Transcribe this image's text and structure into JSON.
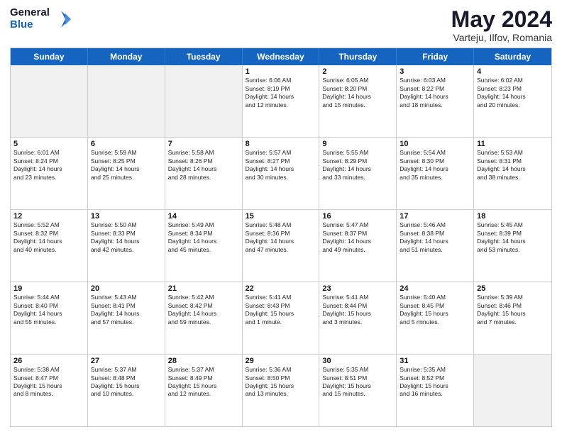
{
  "logo": {
    "line1": "General",
    "line2": "Blue"
  },
  "title": "May 2024",
  "subtitle": "Varteju, Ilfov, Romania",
  "days": [
    "Sunday",
    "Monday",
    "Tuesday",
    "Wednesday",
    "Thursday",
    "Friday",
    "Saturday"
  ],
  "weeks": [
    [
      {
        "day": "",
        "lines": []
      },
      {
        "day": "",
        "lines": []
      },
      {
        "day": "",
        "lines": []
      },
      {
        "day": "1",
        "lines": [
          "Sunrise: 6:06 AM",
          "Sunset: 8:19 PM",
          "Daylight: 14 hours",
          "and 12 minutes."
        ]
      },
      {
        "day": "2",
        "lines": [
          "Sunrise: 6:05 AM",
          "Sunset: 8:20 PM",
          "Daylight: 14 hours",
          "and 15 minutes."
        ]
      },
      {
        "day": "3",
        "lines": [
          "Sunrise: 6:03 AM",
          "Sunset: 8:22 PM",
          "Daylight: 14 hours",
          "and 18 minutes."
        ]
      },
      {
        "day": "4",
        "lines": [
          "Sunrise: 6:02 AM",
          "Sunset: 8:23 PM",
          "Daylight: 14 hours",
          "and 20 minutes."
        ]
      }
    ],
    [
      {
        "day": "5",
        "lines": [
          "Sunrise: 6:01 AM",
          "Sunset: 8:24 PM",
          "Daylight: 14 hours",
          "and 23 minutes."
        ]
      },
      {
        "day": "6",
        "lines": [
          "Sunrise: 5:59 AM",
          "Sunset: 8:25 PM",
          "Daylight: 14 hours",
          "and 25 minutes."
        ]
      },
      {
        "day": "7",
        "lines": [
          "Sunrise: 5:58 AM",
          "Sunset: 8:26 PM",
          "Daylight: 14 hours",
          "and 28 minutes."
        ]
      },
      {
        "day": "8",
        "lines": [
          "Sunrise: 5:57 AM",
          "Sunset: 8:27 PM",
          "Daylight: 14 hours",
          "and 30 minutes."
        ]
      },
      {
        "day": "9",
        "lines": [
          "Sunrise: 5:55 AM",
          "Sunset: 8:29 PM",
          "Daylight: 14 hours",
          "and 33 minutes."
        ]
      },
      {
        "day": "10",
        "lines": [
          "Sunrise: 5:54 AM",
          "Sunset: 8:30 PM",
          "Daylight: 14 hours",
          "and 35 minutes."
        ]
      },
      {
        "day": "11",
        "lines": [
          "Sunrise: 5:53 AM",
          "Sunset: 8:31 PM",
          "Daylight: 14 hours",
          "and 38 minutes."
        ]
      }
    ],
    [
      {
        "day": "12",
        "lines": [
          "Sunrise: 5:52 AM",
          "Sunset: 8:32 PM",
          "Daylight: 14 hours",
          "and 40 minutes."
        ]
      },
      {
        "day": "13",
        "lines": [
          "Sunrise: 5:50 AM",
          "Sunset: 8:33 PM",
          "Daylight: 14 hours",
          "and 42 minutes."
        ]
      },
      {
        "day": "14",
        "lines": [
          "Sunrise: 5:49 AM",
          "Sunset: 8:34 PM",
          "Daylight: 14 hours",
          "and 45 minutes."
        ]
      },
      {
        "day": "15",
        "lines": [
          "Sunrise: 5:48 AM",
          "Sunset: 8:36 PM",
          "Daylight: 14 hours",
          "and 47 minutes."
        ]
      },
      {
        "day": "16",
        "lines": [
          "Sunrise: 5:47 AM",
          "Sunset: 8:37 PM",
          "Daylight: 14 hours",
          "and 49 minutes."
        ]
      },
      {
        "day": "17",
        "lines": [
          "Sunrise: 5:46 AM",
          "Sunset: 8:38 PM",
          "Daylight: 14 hours",
          "and 51 minutes."
        ]
      },
      {
        "day": "18",
        "lines": [
          "Sunrise: 5:45 AM",
          "Sunset: 8:39 PM",
          "Daylight: 14 hours",
          "and 53 minutes."
        ]
      }
    ],
    [
      {
        "day": "19",
        "lines": [
          "Sunrise: 5:44 AM",
          "Sunset: 8:40 PM",
          "Daylight: 14 hours",
          "and 55 minutes."
        ]
      },
      {
        "day": "20",
        "lines": [
          "Sunrise: 5:43 AM",
          "Sunset: 8:41 PM",
          "Daylight: 14 hours",
          "and 57 minutes."
        ]
      },
      {
        "day": "21",
        "lines": [
          "Sunrise: 5:42 AM",
          "Sunset: 8:42 PM",
          "Daylight: 14 hours",
          "and 59 minutes."
        ]
      },
      {
        "day": "22",
        "lines": [
          "Sunrise: 5:41 AM",
          "Sunset: 8:43 PM",
          "Daylight: 15 hours",
          "and 1 minute."
        ]
      },
      {
        "day": "23",
        "lines": [
          "Sunrise: 5:41 AM",
          "Sunset: 8:44 PM",
          "Daylight: 15 hours",
          "and 3 minutes."
        ]
      },
      {
        "day": "24",
        "lines": [
          "Sunrise: 5:40 AM",
          "Sunset: 8:45 PM",
          "Daylight: 15 hours",
          "and 5 minutes."
        ]
      },
      {
        "day": "25",
        "lines": [
          "Sunrise: 5:39 AM",
          "Sunset: 8:46 PM",
          "Daylight: 15 hours",
          "and 7 minutes."
        ]
      }
    ],
    [
      {
        "day": "26",
        "lines": [
          "Sunrise: 5:38 AM",
          "Sunset: 8:47 PM",
          "Daylight: 15 hours",
          "and 8 minutes."
        ]
      },
      {
        "day": "27",
        "lines": [
          "Sunrise: 5:37 AM",
          "Sunset: 8:48 PM",
          "Daylight: 15 hours",
          "and 10 minutes."
        ]
      },
      {
        "day": "28",
        "lines": [
          "Sunrise: 5:37 AM",
          "Sunset: 8:49 PM",
          "Daylight: 15 hours",
          "and 12 minutes."
        ]
      },
      {
        "day": "29",
        "lines": [
          "Sunrise: 5:36 AM",
          "Sunset: 8:50 PM",
          "Daylight: 15 hours",
          "and 13 minutes."
        ]
      },
      {
        "day": "30",
        "lines": [
          "Sunrise: 5:35 AM",
          "Sunset: 8:51 PM",
          "Daylight: 15 hours",
          "and 15 minutes."
        ]
      },
      {
        "day": "31",
        "lines": [
          "Sunrise: 5:35 AM",
          "Sunset: 8:52 PM",
          "Daylight: 15 hours",
          "and 16 minutes."
        ]
      },
      {
        "day": "",
        "lines": []
      }
    ]
  ]
}
